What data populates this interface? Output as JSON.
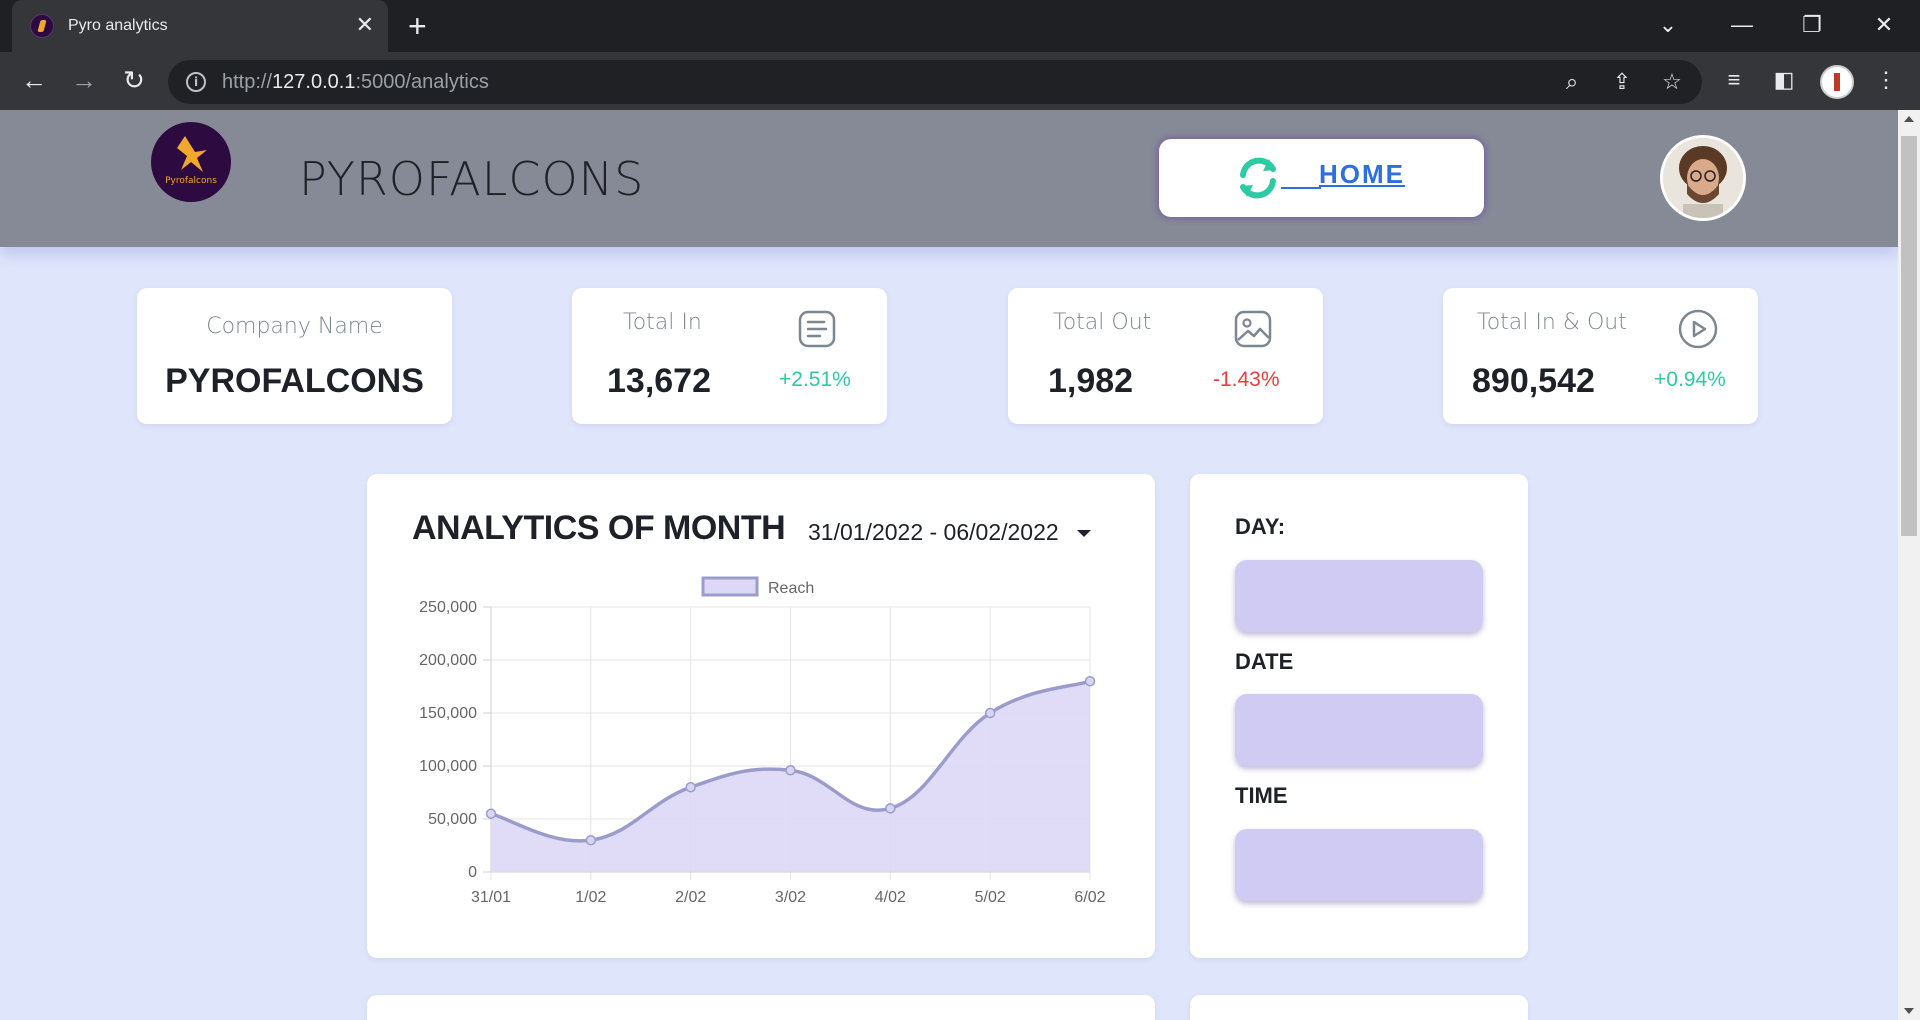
{
  "browser": {
    "tab_title": "Pyro analytics",
    "url_scheme": "http://",
    "url_host": "127.0.0.1",
    "url_rest": ":5000/analytics"
  },
  "header": {
    "logo_text": "Pyrofalcons",
    "brand": "PYROFALCONS",
    "home_label": "HOME"
  },
  "stats": [
    {
      "label": "Company Name",
      "value": "PYROFALCONS",
      "change": "",
      "icon": ""
    },
    {
      "label": "Total In",
      "value": "13,672",
      "change": "+2.51%",
      "trend": "up",
      "icon": "document-icon"
    },
    {
      "label": "Total Out",
      "value": "1,982",
      "change": "-1.43%",
      "trend": "down",
      "icon": "image-icon"
    },
    {
      "label": "Total In & Out",
      "value": "890,542",
      "change": "+0.94%",
      "trend": "up",
      "icon": "play-icon"
    }
  ],
  "analytics": {
    "title": "ANALYTICS OF MONTH",
    "date_range": "31/01/2022 - 06/02/2022"
  },
  "side_panel": {
    "day_label": "DAY:",
    "date_label": "DATE",
    "time_label": "TIME"
  },
  "colors": {
    "accent_line": "#9a9ccc",
    "fill": "#ddd8f6",
    "positive": "#2dcba3",
    "negative": "#ef3b3b"
  },
  "chart_data": {
    "type": "area",
    "categories": [
      "31/01",
      "1/02",
      "2/02",
      "3/02",
      "4/02",
      "5/02",
      "6/02"
    ],
    "series": [
      {
        "name": "Reach",
        "values": [
          55000,
          30000,
          80000,
          96000,
          60000,
          150000,
          180000
        ]
      }
    ],
    "yticks": [
      "250,000",
      "200,000",
      "150,000",
      "100,000",
      "50,000",
      "0"
    ],
    "ylim": [
      0,
      250000
    ],
    "grid": true,
    "legend": "top"
  }
}
